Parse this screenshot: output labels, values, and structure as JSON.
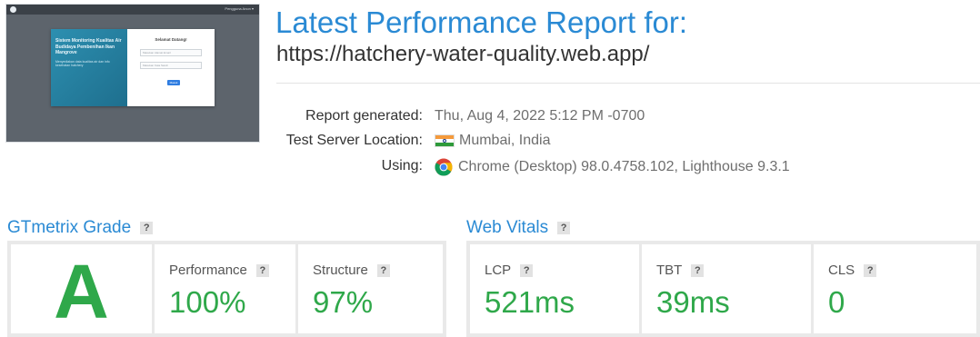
{
  "thumbnail": {
    "menu_text": "Pengguna Anon ▾",
    "left_heading": "Sistem Monitoring Kualitas Air Budidaya Pembenihan Ikan Mangrove",
    "left_sub": "Menyediakan data kualitas air dan info kesehatan hatchery",
    "card_title": "Selamat Datang!",
    "field1_placeholder": "Masukan Alamat Email",
    "field2_placeholder": "Masukan Kata Sandi",
    "button_label": "Masuk"
  },
  "report": {
    "title": "Latest Performance Report for:",
    "url": "https://hatchery-water-quality.web.app/"
  },
  "meta": {
    "generated_label": "Report generated:",
    "generated_value": "Thu, Aug 4, 2022 5:12 PM -0700",
    "location_label": "Test Server Location:",
    "location_value": "Mumbai, India",
    "location_flag": "india-flag-icon",
    "using_label": "Using:",
    "using_value": "Chrome (Desktop) 98.0.4758.102, Lighthouse 9.3.1",
    "using_icon": "chrome-icon"
  },
  "gtmetrix": {
    "heading": "GTmetrix Grade",
    "help": "?",
    "grade": "A",
    "performance_label": "Performance",
    "performance_value": "100%",
    "structure_label": "Structure",
    "structure_value": "97%"
  },
  "web_vitals": {
    "heading": "Web Vitals",
    "help": "?",
    "lcp_label": "LCP",
    "lcp_value": "521ms",
    "tbt_label": "TBT",
    "tbt_value": "39ms",
    "cls_label": "CLS",
    "cls_value": "0"
  },
  "colors": {
    "accent_blue": "#2a8ad4",
    "good_green": "#2fa84a"
  }
}
